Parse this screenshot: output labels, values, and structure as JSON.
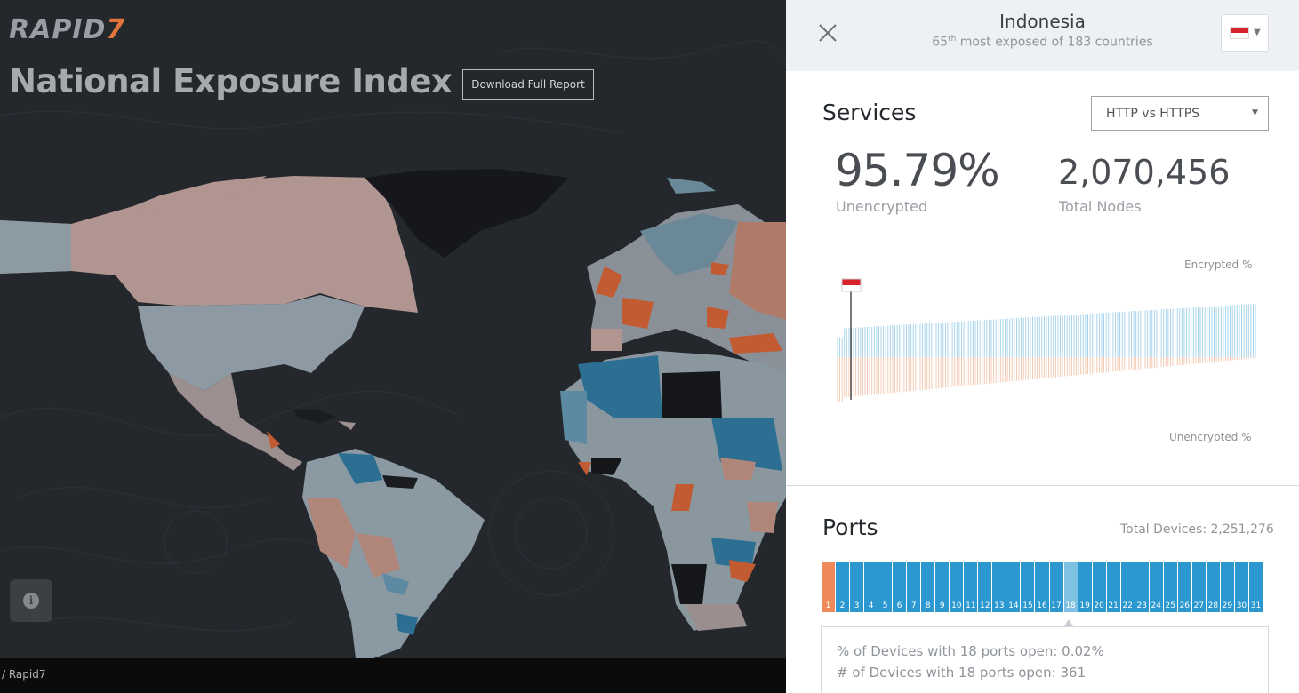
{
  "brand": {
    "name": "RAPID",
    "suffix": "7"
  },
  "page": {
    "title": "National Exposure Index",
    "download_label": "Download Full Report",
    "footer": "/ Rapid7"
  },
  "header": {
    "country": "Indonesia",
    "rank_number": "65",
    "rank_suffix": "th",
    "rank_text": " most exposed of 183 countries"
  },
  "services": {
    "title": "Services",
    "selector": "HTTP vs HTTPS",
    "unencrypted_pct": "95.79%",
    "unencrypted_label": "Unencrypted",
    "total_nodes": "2,070,456",
    "total_nodes_label": "Total Nodes",
    "axis_top": "Encrypted %",
    "axis_bottom": "Unencrypted %"
  },
  "ports": {
    "title": "Ports",
    "total_devices": "Total Devices: 2,251,276",
    "labels": [
      "1",
      "2",
      "3",
      "4",
      "5",
      "6",
      "7",
      "8",
      "9",
      "10",
      "11",
      "12",
      "13",
      "14",
      "15",
      "16",
      "17",
      "18",
      "19",
      "20",
      "21",
      "22",
      "23",
      "24",
      "25",
      "26",
      "27",
      "28",
      "29",
      "30",
      "31"
    ],
    "selected": "18",
    "tooltip_pct": "% of Devices with 18 ports open: 0.02%",
    "tooltip_count": "# of Devices with 18 ports open: 361"
  },
  "colors": {
    "accent_orange": "#f0895a",
    "accent_blue": "#2b98cf",
    "flag_red": "#d9232b"
  }
}
